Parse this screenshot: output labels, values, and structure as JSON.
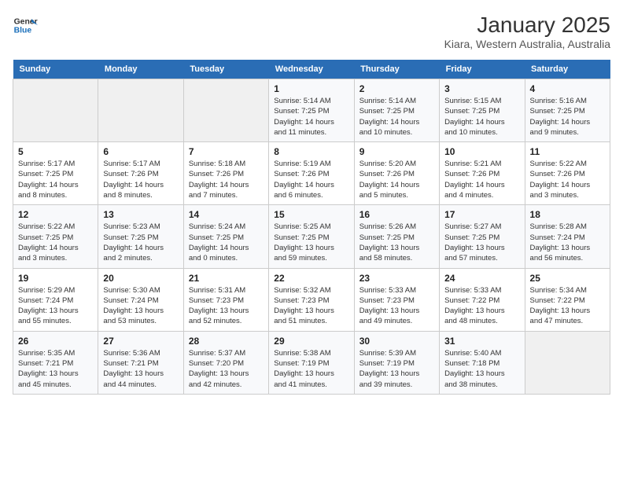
{
  "logo": {
    "line1": "General",
    "line2": "Blue"
  },
  "title": "January 2025",
  "subtitle": "Kiara, Western Australia, Australia",
  "days_of_week": [
    "Sunday",
    "Monday",
    "Tuesday",
    "Wednesday",
    "Thursday",
    "Friday",
    "Saturday"
  ],
  "weeks": [
    [
      {
        "day": "",
        "info": ""
      },
      {
        "day": "",
        "info": ""
      },
      {
        "day": "",
        "info": ""
      },
      {
        "day": "1",
        "info": "Sunrise: 5:14 AM\nSunset: 7:25 PM\nDaylight: 14 hours\nand 11 minutes."
      },
      {
        "day": "2",
        "info": "Sunrise: 5:14 AM\nSunset: 7:25 PM\nDaylight: 14 hours\nand 10 minutes."
      },
      {
        "day": "3",
        "info": "Sunrise: 5:15 AM\nSunset: 7:25 PM\nDaylight: 14 hours\nand 10 minutes."
      },
      {
        "day": "4",
        "info": "Sunrise: 5:16 AM\nSunset: 7:25 PM\nDaylight: 14 hours\nand 9 minutes."
      }
    ],
    [
      {
        "day": "5",
        "info": "Sunrise: 5:17 AM\nSunset: 7:25 PM\nDaylight: 14 hours\nand 8 minutes."
      },
      {
        "day": "6",
        "info": "Sunrise: 5:17 AM\nSunset: 7:26 PM\nDaylight: 14 hours\nand 8 minutes."
      },
      {
        "day": "7",
        "info": "Sunrise: 5:18 AM\nSunset: 7:26 PM\nDaylight: 14 hours\nand 7 minutes."
      },
      {
        "day": "8",
        "info": "Sunrise: 5:19 AM\nSunset: 7:26 PM\nDaylight: 14 hours\nand 6 minutes."
      },
      {
        "day": "9",
        "info": "Sunrise: 5:20 AM\nSunset: 7:26 PM\nDaylight: 14 hours\nand 5 minutes."
      },
      {
        "day": "10",
        "info": "Sunrise: 5:21 AM\nSunset: 7:26 PM\nDaylight: 14 hours\nand 4 minutes."
      },
      {
        "day": "11",
        "info": "Sunrise: 5:22 AM\nSunset: 7:26 PM\nDaylight: 14 hours\nand 3 minutes."
      }
    ],
    [
      {
        "day": "12",
        "info": "Sunrise: 5:22 AM\nSunset: 7:25 PM\nDaylight: 14 hours\nand 3 minutes."
      },
      {
        "day": "13",
        "info": "Sunrise: 5:23 AM\nSunset: 7:25 PM\nDaylight: 14 hours\nand 2 minutes."
      },
      {
        "day": "14",
        "info": "Sunrise: 5:24 AM\nSunset: 7:25 PM\nDaylight: 14 hours\nand 0 minutes."
      },
      {
        "day": "15",
        "info": "Sunrise: 5:25 AM\nSunset: 7:25 PM\nDaylight: 13 hours\nand 59 minutes."
      },
      {
        "day": "16",
        "info": "Sunrise: 5:26 AM\nSunset: 7:25 PM\nDaylight: 13 hours\nand 58 minutes."
      },
      {
        "day": "17",
        "info": "Sunrise: 5:27 AM\nSunset: 7:25 PM\nDaylight: 13 hours\nand 57 minutes."
      },
      {
        "day": "18",
        "info": "Sunrise: 5:28 AM\nSunset: 7:24 PM\nDaylight: 13 hours\nand 56 minutes."
      }
    ],
    [
      {
        "day": "19",
        "info": "Sunrise: 5:29 AM\nSunset: 7:24 PM\nDaylight: 13 hours\nand 55 minutes."
      },
      {
        "day": "20",
        "info": "Sunrise: 5:30 AM\nSunset: 7:24 PM\nDaylight: 13 hours\nand 53 minutes."
      },
      {
        "day": "21",
        "info": "Sunrise: 5:31 AM\nSunset: 7:23 PM\nDaylight: 13 hours\nand 52 minutes."
      },
      {
        "day": "22",
        "info": "Sunrise: 5:32 AM\nSunset: 7:23 PM\nDaylight: 13 hours\nand 51 minutes."
      },
      {
        "day": "23",
        "info": "Sunrise: 5:33 AM\nSunset: 7:23 PM\nDaylight: 13 hours\nand 49 minutes."
      },
      {
        "day": "24",
        "info": "Sunrise: 5:33 AM\nSunset: 7:22 PM\nDaylight: 13 hours\nand 48 minutes."
      },
      {
        "day": "25",
        "info": "Sunrise: 5:34 AM\nSunset: 7:22 PM\nDaylight: 13 hours\nand 47 minutes."
      }
    ],
    [
      {
        "day": "26",
        "info": "Sunrise: 5:35 AM\nSunset: 7:21 PM\nDaylight: 13 hours\nand 45 minutes."
      },
      {
        "day": "27",
        "info": "Sunrise: 5:36 AM\nSunset: 7:21 PM\nDaylight: 13 hours\nand 44 minutes."
      },
      {
        "day": "28",
        "info": "Sunrise: 5:37 AM\nSunset: 7:20 PM\nDaylight: 13 hours\nand 42 minutes."
      },
      {
        "day": "29",
        "info": "Sunrise: 5:38 AM\nSunset: 7:19 PM\nDaylight: 13 hours\nand 41 minutes."
      },
      {
        "day": "30",
        "info": "Sunrise: 5:39 AM\nSunset: 7:19 PM\nDaylight: 13 hours\nand 39 minutes."
      },
      {
        "day": "31",
        "info": "Sunrise: 5:40 AM\nSunset: 7:18 PM\nDaylight: 13 hours\nand 38 minutes."
      },
      {
        "day": "",
        "info": ""
      }
    ]
  ]
}
